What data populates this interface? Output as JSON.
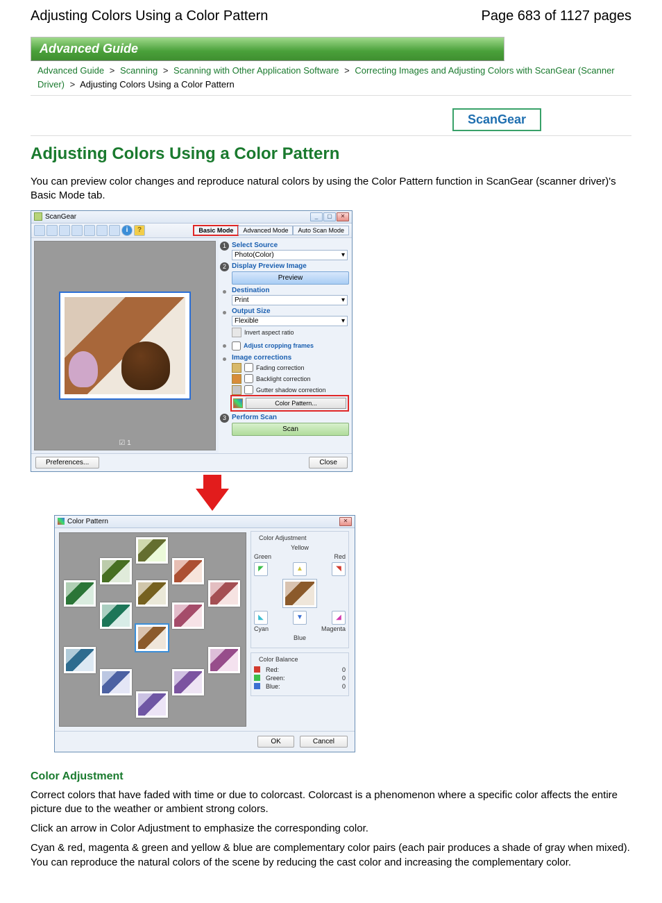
{
  "header": {
    "title": "Adjusting Colors Using a Color Pattern",
    "page_indicator": "Page 683 of 1127 pages"
  },
  "banner": "Advanced Guide",
  "breadcrumb": {
    "items": [
      "Advanced Guide",
      "Scanning",
      "Scanning with Other Application Software",
      "Correcting Images and Adjusting Colors with ScanGear (Scanner Driver)"
    ],
    "current": "Adjusting Colors Using a Color Pattern"
  },
  "badge": "ScanGear",
  "main_title": "Adjusting Colors Using a Color Pattern",
  "intro": "You can preview color changes and reproduce natural colors by using the Color Pattern function in ScanGear (scanner driver)'s Basic Mode tab.",
  "app": {
    "title": "ScanGear",
    "tabs": [
      "Basic Mode",
      "Advanced Mode",
      "Auto Scan Mode"
    ],
    "preview_badge": "☑ 1",
    "sections": {
      "select_source": "Select Source",
      "select_source_value": "Photo(Color)",
      "display_preview": "Display Preview Image",
      "preview_btn": "Preview",
      "destination": "Destination",
      "destination_value": "Print",
      "output_size": "Output Size",
      "output_size_value": "Flexible",
      "invert_ar": "Invert aspect ratio",
      "adjust_crop": "Adjust cropping frames",
      "image_corrections": "Image corrections",
      "fading": "Fading correction",
      "backlight": "Backlight correction",
      "gutter": "Gutter shadow correction",
      "color_pattern_btn": "Color Pattern...",
      "perform_scan": "Perform Scan",
      "scan_btn": "Scan",
      "preferences_btn": "Preferences...",
      "close_btn": "Close"
    }
  },
  "cp": {
    "title": "Color Pattern",
    "adjustment_legend": "Color Adjustment",
    "labels": {
      "yellow": "Yellow",
      "green": "Green",
      "red": "Red",
      "cyan": "Cyan",
      "blue": "Blue",
      "magenta": "Magenta"
    },
    "balance_legend": "Color Balance",
    "balance": [
      {
        "name": "Red:",
        "value": "0",
        "color": "#d23b2f"
      },
      {
        "name": "Green:",
        "value": "0",
        "color": "#3bbf4b"
      },
      {
        "name": "Blue:",
        "value": "0",
        "color": "#3b6fd2"
      }
    ],
    "ok": "OK",
    "cancel": "Cancel"
  },
  "section": {
    "heading": "Color Adjustment",
    "p1": "Correct colors that have faded with time or due to colorcast. Colorcast is a phenomenon where a specific color affects the entire picture due to the weather or ambient strong colors.",
    "p2": "Click an arrow in Color Adjustment to emphasize the corresponding color.",
    "p3": "Cyan & red, magenta & green and yellow & blue are complementary color pairs (each pair produces a shade of gray when mixed). You can reproduce the natural colors of the scene by reducing the cast color and increasing the complementary color."
  }
}
